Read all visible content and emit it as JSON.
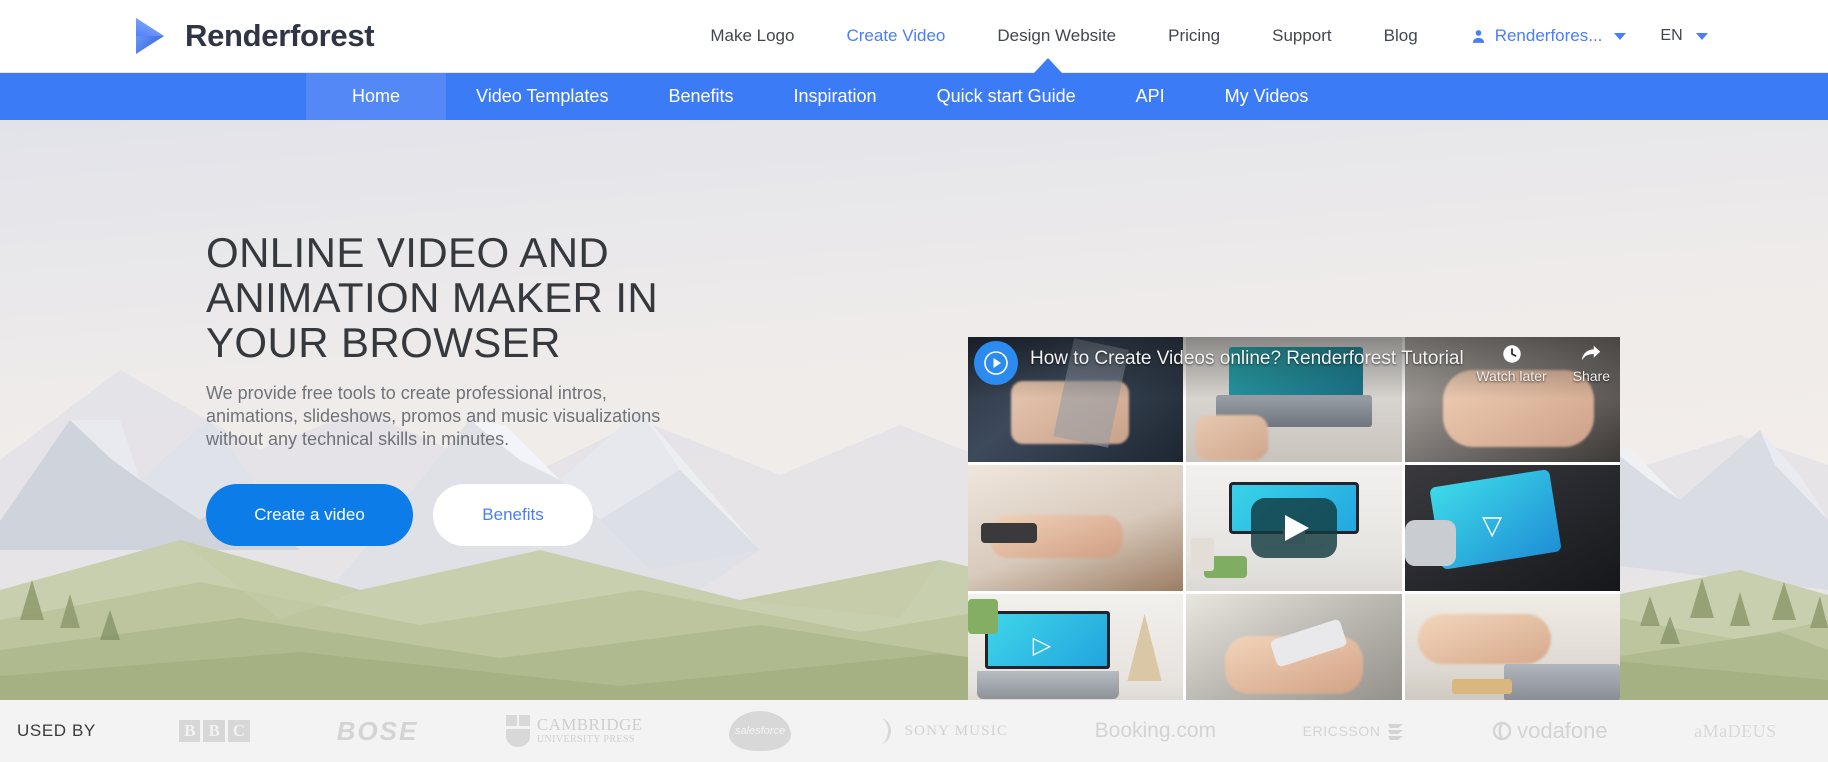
{
  "header": {
    "brand": "Renderforest",
    "brand_logo_icon": "play-triangle-logo",
    "nav": [
      {
        "label": "Make Logo",
        "active": false
      },
      {
        "label": "Create Video",
        "active": true
      },
      {
        "label": "Design Website",
        "active": false
      },
      {
        "label": "Pricing",
        "active": false
      },
      {
        "label": "Support",
        "active": false
      },
      {
        "label": "Blog",
        "active": false
      }
    ],
    "account": {
      "label": "Renderfores...",
      "icon": "person-icon",
      "caret_icon": "chevron-down-icon"
    },
    "language": {
      "label": "EN",
      "caret_icon": "chevron-down-icon"
    }
  },
  "subnav": {
    "background_color": "#3c7bf6",
    "highlight_color": "#5588f7",
    "items": [
      {
        "label": "Home",
        "highlighted": true
      },
      {
        "label": "Video Templates",
        "highlighted": false
      },
      {
        "label": "Benefits",
        "highlighted": false
      },
      {
        "label": "Inspiration",
        "highlighted": false
      },
      {
        "label": "Quick start Guide",
        "highlighted": false
      },
      {
        "label": "API",
        "highlighted": false
      },
      {
        "label": "My Videos",
        "highlighted": false
      }
    ]
  },
  "hero": {
    "title": "ONLINE VIDEO AND ANIMATION MAKER IN YOUR BROWSER",
    "subtitle": "We provide free tools to create professional intros, animations, slideshows, promos and music visualizations without any technical skills in minutes.",
    "primary_button": "Create a video",
    "secondary_button": "Benefits",
    "primary_button_color": "#0b7ce8",
    "secondary_button_text_color": "#4a7dfc"
  },
  "video": {
    "title": "How to Create Videos online? Renderforest Tutorial",
    "play_icon": "youtube-play-icon",
    "watch_later": {
      "label": "Watch later",
      "icon": "clock-icon"
    },
    "share": {
      "label": "Share",
      "icon": "share-arrow-icon"
    },
    "center_play_icon": "play-button-icon"
  },
  "used_by": {
    "label": "USED BY",
    "logos": [
      {
        "name": "BBC",
        "letters": [
          "B",
          "B",
          "C"
        ]
      },
      {
        "name": "BOSE"
      },
      {
        "name": "Cambridge University Press",
        "line1": "CAMBRIDGE",
        "line2": "UNIVERSITY PRESS"
      },
      {
        "name": "salesforce"
      },
      {
        "name": "SONY MUSIC"
      },
      {
        "name": "Booking.com"
      },
      {
        "name": "ERICSSON"
      },
      {
        "name": "vodafone"
      },
      {
        "name": "aMaDEUS"
      }
    ]
  }
}
